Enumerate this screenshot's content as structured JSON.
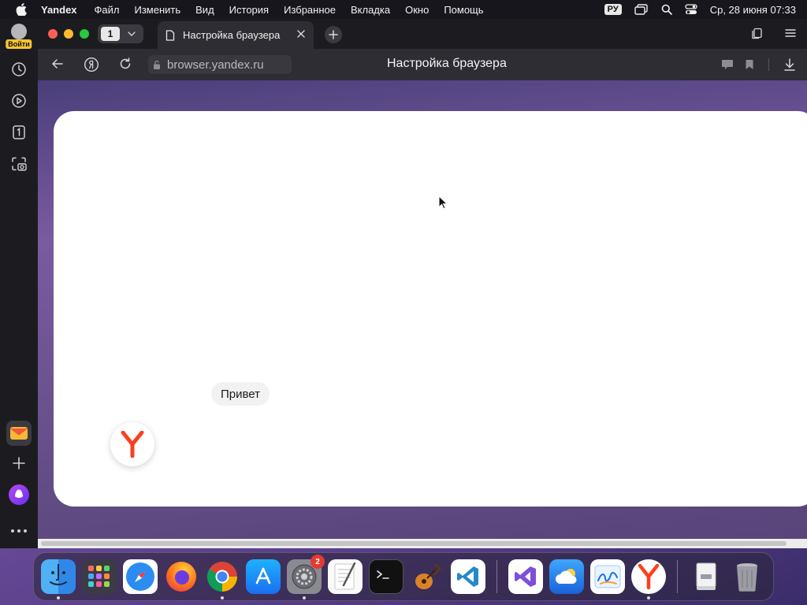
{
  "menubar": {
    "app_name": "Yandex",
    "items": [
      "Файл",
      "Изменить",
      "Вид",
      "История",
      "Избранное",
      "Вкладка",
      "Окно",
      "Помощь"
    ],
    "input_source": "РУ",
    "datetime": "Ср, 28 июня  07:33"
  },
  "sidebar": {
    "login_label": "Войти"
  },
  "tabbar": {
    "tab_count": "1",
    "active_tab_title": "Настройка браузера"
  },
  "toolbar": {
    "url": "browser.yandex.ru",
    "page_title": "Настройка браузера"
  },
  "content": {
    "greeting_chip": "Привет"
  },
  "dock": {
    "settings_badge": "2"
  },
  "colors": {
    "close": "#ff5f57",
    "minimize": "#febc2e",
    "zoom": "#28c840",
    "yandex_red": "#fc3f1d"
  }
}
